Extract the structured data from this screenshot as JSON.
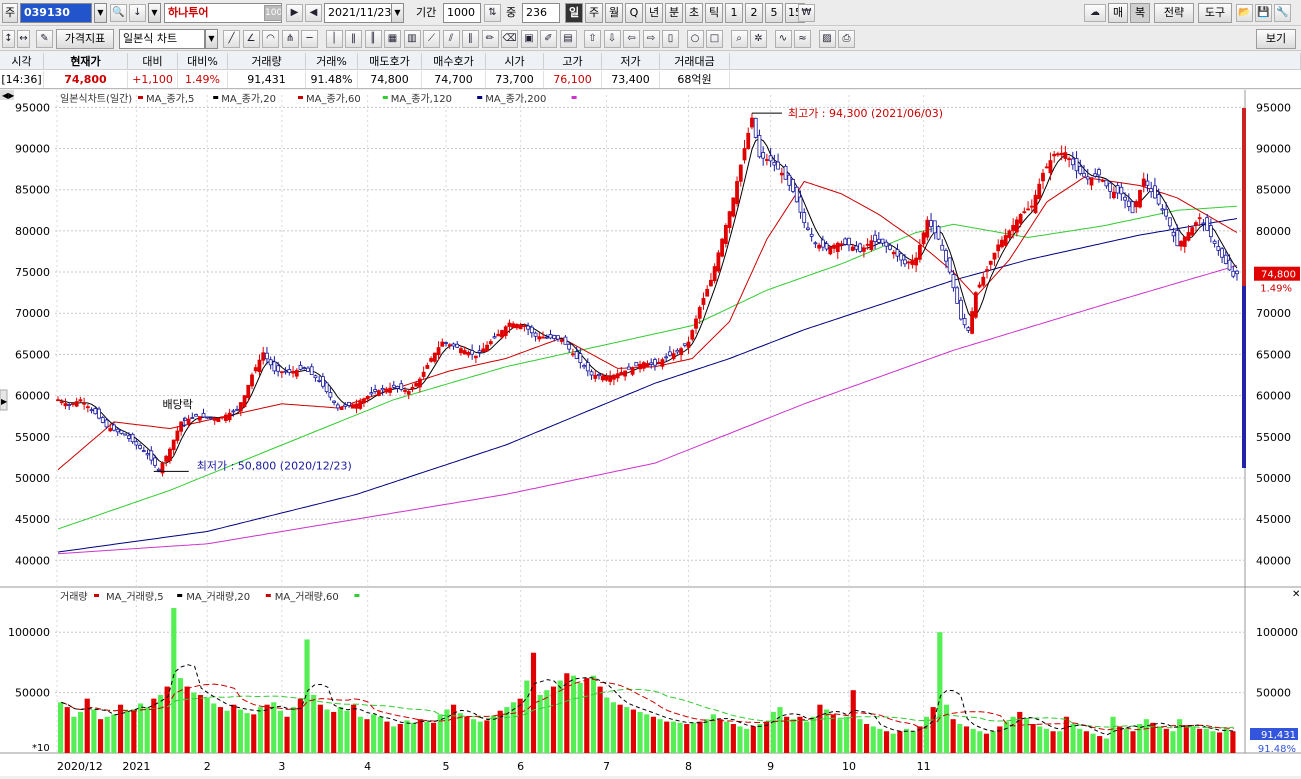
{
  "toolbar1": {
    "market_label": "주",
    "code": "039130",
    "stock_name": "하나투어",
    "name_badge": "100",
    "date": "2021/11/23",
    "period_label": "기간",
    "period_value": "1000",
    "count_label": "중",
    "count_value": "236",
    "intervals": [
      "일",
      "주",
      "월",
      "Q",
      "년",
      "분",
      "초",
      "틱",
      "1",
      "2",
      "5",
      "15"
    ],
    "right_buttons": [
      "매",
      "복",
      "전략",
      "도구"
    ]
  },
  "toolbar2": {
    "indicator_button": "가격지표",
    "chart_type": "일본식 차트",
    "view_button": "보기"
  },
  "quote": {
    "headers": [
      "시각",
      "현재가",
      "대비",
      "대비%",
      "거래량",
      "거래%",
      "매도호가",
      "매수호가",
      "시가",
      "고가",
      "저가",
      "거래대금"
    ],
    "values": [
      "[14:36]",
      "74,800",
      "+1,100",
      "1.49%",
      "91,431",
      "91.48%",
      "74,800",
      "74,700",
      "73,700",
      "76,100",
      "73,400",
      "68억원"
    ]
  },
  "price_panel": {
    "title": "일본식차트(일간)",
    "legend": [
      "MA_종가,5",
      "MA_종가,20",
      "MA_종가,60",
      "MA_종가,120",
      "MA_종가,200"
    ],
    "legend_colors": [
      "#cc0000",
      "#000000",
      "#cc0000",
      "#33cc33",
      "#000080",
      "#cc33cc"
    ],
    "y_ticks": [
      "95000",
      "90000",
      "85000",
      "80000",
      "75000",
      "70000",
      "65000",
      "60000",
      "55000",
      "50000",
      "45000",
      "40000"
    ],
    "high_annotation": "최고가 : 94,300 (2021/06/03)",
    "low_annotation": "최저가 : 50,800 (2020/12/23)",
    "dividend_label": "배당락",
    "last_price_box": "74,800",
    "last_change": "1.49%"
  },
  "volume_panel": {
    "title": "거래량",
    "legend": [
      "MA_거래량,5",
      "MA_거래량,20",
      "MA_거래량,60"
    ],
    "y_ticks": [
      "100000",
      "50000"
    ],
    "scale_label": "*10",
    "last_volume_box": "91,431",
    "last_volume_pct": "91.48%"
  },
  "x_axis": [
    "2020/12",
    "2021",
    "2",
    "3",
    "4",
    "5",
    "6",
    "7",
    "8",
    "9",
    "10",
    "11"
  ],
  "colors": {
    "up": "#e00000",
    "down": "#1a1aa0",
    "ma5": "#000000",
    "ma20": "#cc0000",
    "ma60": "#33cc33",
    "ma120": "#000080",
    "ma200": "#cc33cc",
    "vol": "#55ee55"
  },
  "chart_data": {
    "type": "candlestick",
    "ylim": [
      37000,
      96500
    ],
    "volume_ylim": [
      0,
      125000
    ],
    "x": [
      "2020/12",
      "2021",
      "2",
      "3",
      "4",
      "5",
      "6",
      "7",
      "8",
      "9",
      "10",
      "11"
    ],
    "close_path": [
      [
        0,
        59500
      ],
      [
        3,
        58800
      ],
      [
        6,
        59500
      ],
      [
        10,
        57800
      ],
      [
        13,
        56200
      ],
      [
        18,
        55200
      ],
      [
        24,
        52800
      ],
      [
        27,
        50900
      ],
      [
        30,
        53500
      ],
      [
        33,
        56800
      ],
      [
        37,
        57500
      ],
      [
        43,
        57200
      ],
      [
        48,
        58300
      ],
      [
        50,
        60000
      ],
      [
        52,
        62500
      ],
      [
        55,
        65200
      ],
      [
        58,
        63000
      ],
      [
        62,
        62800
      ],
      [
        66,
        63300
      ],
      [
        70,
        61800
      ],
      [
        75,
        58500
      ],
      [
        80,
        59000
      ],
      [
        85,
        60500
      ],
      [
        90,
        61000
      ],
      [
        94,
        60500
      ],
      [
        97,
        62000
      ],
      [
        100,
        64500
      ],
      [
        103,
        66500
      ],
      [
        108,
        65700
      ],
      [
        112,
        64800
      ],
      [
        117,
        67000
      ],
      [
        121,
        68800
      ],
      [
        125,
        68500
      ],
      [
        128,
        67200
      ],
      [
        132,
        67000
      ],
      [
        135,
        66800
      ],
      [
        139,
        64500
      ],
      [
        143,
        62500
      ],
      [
        148,
        62300
      ],
      [
        152,
        63000
      ],
      [
        157,
        64000
      ],
      [
        160,
        63700
      ],
      [
        163,
        64700
      ],
      [
        166,
        65300
      ],
      [
        169,
        66500
      ],
      [
        172,
        70700
      ],
      [
        175,
        74000
      ],
      [
        178,
        79000
      ],
      [
        181,
        84000
      ],
      [
        184,
        90000
      ],
      [
        186,
        93700
      ],
      [
        188,
        89000
      ],
      [
        191,
        88500
      ],
      [
        194,
        87000
      ],
      [
        197,
        84800
      ],
      [
        200,
        81000
      ],
      [
        203,
        78500
      ],
      [
        206,
        77800
      ],
      [
        209,
        78500
      ],
      [
        212,
        78300
      ],
      [
        215,
        77500
      ],
      [
        218,
        78800
      ],
      [
        221,
        78500
      ],
      [
        224,
        77400
      ],
      [
        227,
        76000
      ],
      [
        230,
        76700
      ],
      [
        233,
        81300
      ],
      [
        236,
        79000
      ],
      [
        239,
        75000
      ],
      [
        242,
        69300
      ],
      [
        244,
        67900
      ],
      [
        246,
        72500
      ],
      [
        249,
        75300
      ],
      [
        252,
        78300
      ],
      [
        255,
        80000
      ],
      [
        258,
        82000
      ],
      [
        261,
        83000
      ],
      [
        264,
        87000
      ],
      [
        267,
        89300
      ],
      [
        270,
        89500
      ],
      [
        273,
        87300
      ],
      [
        276,
        86300
      ],
      [
        279,
        86800
      ],
      [
        282,
        84800
      ],
      [
        285,
        84500
      ],
      [
        288,
        82200
      ],
      [
        291,
        86300
      ],
      [
        294,
        84000
      ],
      [
        297,
        81800
      ],
      [
        300,
        78200
      ],
      [
        303,
        79800
      ],
      [
        306,
        81600
      ],
      [
        309,
        79300
      ],
      [
        312,
        76800
      ],
      [
        315,
        74500
      ],
      [
        316,
        74800
      ]
    ],
    "ma20_path": [
      [
        0,
        51000
      ],
      [
        15,
        56800
      ],
      [
        30,
        56000
      ],
      [
        45,
        57500
      ],
      [
        60,
        59000
      ],
      [
        75,
        58500
      ],
      [
        90,
        60800
      ],
      [
        105,
        63000
      ],
      [
        120,
        64500
      ],
      [
        135,
        67000
      ],
      [
        150,
        63300
      ],
      [
        160,
        63500
      ],
      [
        170,
        64500
      ],
      [
        180,
        69000
      ],
      [
        190,
        79000
      ],
      [
        200,
        86000
      ],
      [
        210,
        84500
      ],
      [
        220,
        82000
      ],
      [
        230,
        78800
      ],
      [
        240,
        75000
      ],
      [
        246,
        72000
      ],
      [
        255,
        76500
      ],
      [
        265,
        83500
      ],
      [
        275,
        86500
      ],
      [
        290,
        85500
      ],
      [
        300,
        84000
      ],
      [
        316,
        79800
      ]
    ],
    "ma60_path": [
      [
        0,
        43800
      ],
      [
        30,
        48500
      ],
      [
        60,
        54000
      ],
      [
        90,
        59500
      ],
      [
        120,
        63500
      ],
      [
        150,
        66500
      ],
      [
        170,
        68500
      ],
      [
        190,
        72800
      ],
      [
        210,
        76000
      ],
      [
        230,
        79800
      ],
      [
        240,
        80800
      ],
      [
        260,
        79200
      ],
      [
        280,
        80600
      ],
      [
        300,
        82500
      ],
      [
        316,
        83000
      ]
    ],
    "ma120_path": [
      [
        0,
        41000
      ],
      [
        40,
        43500
      ],
      [
        80,
        48000
      ],
      [
        120,
        54000
      ],
      [
        160,
        61500
      ],
      [
        180,
        64500
      ],
      [
        200,
        68000
      ],
      [
        220,
        71000
      ],
      [
        240,
        74000
      ],
      [
        260,
        76500
      ],
      [
        290,
        79500
      ],
      [
        316,
        81500
      ]
    ],
    "ma200_path": [
      [
        0,
        40800
      ],
      [
        40,
        42000
      ],
      [
        80,
        45000
      ],
      [
        120,
        48000
      ],
      [
        160,
        51800
      ],
      [
        200,
        59000
      ],
      [
        240,
        65500
      ],
      [
        280,
        71000
      ],
      [
        316,
        75800
      ]
    ],
    "volume_bars": [
      42,
      38,
      30,
      34,
      45,
      36,
      28,
      30,
      32,
      40,
      35,
      36,
      41,
      38,
      45,
      48,
      55,
      120,
      62,
      55,
      50,
      48,
      46,
      41,
      38,
      35,
      40,
      36,
      33,
      32,
      38,
      40,
      42,
      35,
      30,
      38,
      45,
      94,
      48,
      40,
      36,
      34,
      38,
      35,
      40,
      30,
      28,
      32,
      30,
      26,
      22,
      24,
      27,
      25,
      28,
      26,
      25,
      32,
      36,
      40,
      33,
      30,
      28,
      26,
      27,
      31,
      35,
      38,
      42,
      45,
      60,
      83,
      48,
      52,
      55,
      60,
      66,
      64,
      58,
      62,
      64,
      55,
      46,
      42,
      40,
      38,
      36,
      34,
      32,
      30,
      28,
      26,
      26,
      25,
      24,
      25,
      26,
      28,
      32,
      28,
      26,
      24,
      22,
      20,
      22,
      24,
      26,
      34,
      38,
      30,
      28,
      30,
      26,
      30,
      40,
      36,
      32,
      28,
      30,
      52,
      28,
      24,
      22,
      20,
      18,
      16,
      18,
      20,
      18,
      22,
      30,
      38,
      100,
      40,
      28,
      24,
      22,
      20,
      18,
      16,
      18,
      22,
      26,
      30,
      34,
      28,
      24,
      22,
      20,
      18,
      18,
      30,
      24,
      20,
      18,
      16,
      14,
      12,
      30,
      22,
      20,
      18,
      24,
      28,
      25,
      22,
      20,
      18,
      28,
      23,
      22,
      20,
      20,
      18,
      17,
      20,
      18
    ]
  }
}
